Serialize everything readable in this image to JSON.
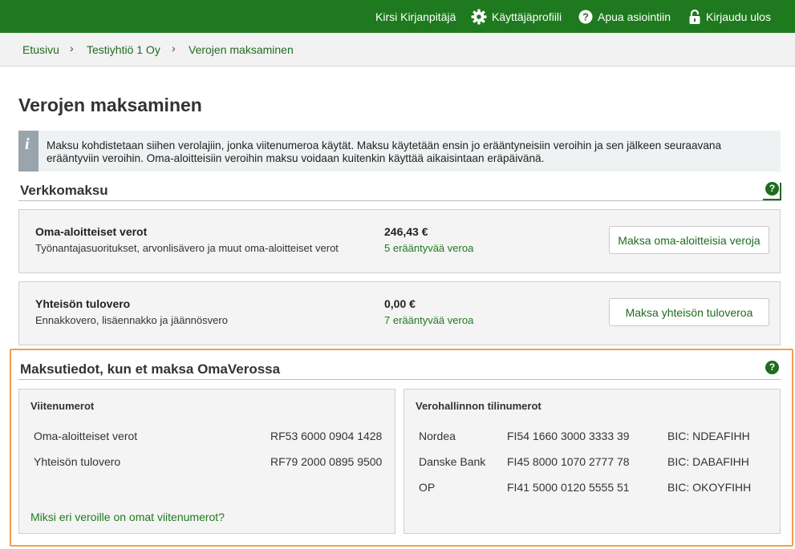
{
  "topbar": {
    "user": "Kirsi Kirjanpitäjä",
    "profile": "Käyttäjäprofiili",
    "help": "Apua asiointiin",
    "logout": "Kirjaudu ulos"
  },
  "breadcrumb": {
    "items": [
      "Etusivu",
      "Testiyhtiö 1 Oy",
      "Verojen maksaminen"
    ],
    "separator": "›"
  },
  "page_title": "Verojen maksaminen",
  "info": {
    "icon": "i",
    "text": "Maksu kohdistetaan siihen verolajiin, jonka viitenumeroa käytät. Maksu käytetään ensin jo erääntyneisiin veroihin ja sen jälkeen seuraavana erääntyviin veroihin. Oma-aloitteisiin veroihin maksu voidaan kuitenkin käyttää aikaisintaan eräpäivänä."
  },
  "verkkomaksu": {
    "title": "Verkkomaksu",
    "help": "?",
    "cards": [
      {
        "title": "Oma-aloitteiset verot",
        "description": "Työnantajasuoritukset, arvonlisävero ja muut oma-aloitteiset verot",
        "amount": "246,43 €",
        "due": "5 erääntyvää veroa",
        "button": "Maksa oma-aloitteisia veroja"
      },
      {
        "title": "Yhteisön tulovero",
        "description": "Ennakkovero, lisäennakko ja jäännösvero",
        "amount": "0,00 €",
        "due": "7 erääntyvää veroa",
        "button": "Maksa yhteisön tuloveroa"
      }
    ]
  },
  "maksutiedot": {
    "title": "Maksutiedot, kun et maksa OmaVerossa",
    "help": "?",
    "viitenumerot": {
      "title": "Viitenumerot",
      "rows": [
        {
          "label": "Oma-aloitteiset verot",
          "value": "RF53 6000 0904 1428"
        },
        {
          "label": "Yhteisön tulovero",
          "value": "RF79 2000 0895 9500"
        }
      ],
      "link": "Miksi eri veroille on omat viitenumerot?"
    },
    "tilinumerot": {
      "title": "Verohallinnon tilinumerot",
      "rows": [
        {
          "bank": "Nordea",
          "iban": "FI54 1660 3000 3333 39",
          "bic": "BIC: NDEAFIHH"
        },
        {
          "bank": "Danske Bank",
          "iban": "FI45 8000 1070 2777 78",
          "bic": "BIC: DABAFIHH"
        },
        {
          "bank": "OP",
          "iban": "FI41 5000 0120 5555 51",
          "bic": "BIC: OKOYFIHH"
        }
      ]
    }
  },
  "colors": {
    "brand_green": "#1f7a1f",
    "highlight_orange": "#f0a050"
  },
  "icons": [
    "gear-icon",
    "help-circle-icon",
    "lock-icon",
    "info-icon",
    "chevron-right-icon"
  ]
}
